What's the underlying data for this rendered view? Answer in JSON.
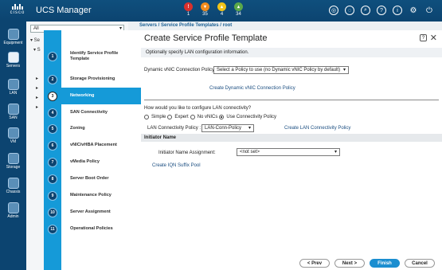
{
  "app": {
    "logo": "cisco",
    "title": "UCS Manager"
  },
  "faults": [
    {
      "label": "1",
      "color": "#d9302c",
      "icon": "critical-icon"
    },
    {
      "label": "35",
      "color": "#f08b1c",
      "icon": "major-icon"
    },
    {
      "label": "4",
      "color": "#f0c419",
      "icon": "minor-icon"
    },
    {
      "label": "34",
      "color": "#5aa84a",
      "icon": "warning-icon"
    }
  ],
  "rail": [
    {
      "label": "Equipment"
    },
    {
      "label": "Servers"
    },
    {
      "label": "LAN"
    },
    {
      "label": "SAN"
    },
    {
      "label": "VM"
    },
    {
      "label": "Storage"
    },
    {
      "label": "Chassis"
    },
    {
      "label": "Admin"
    }
  ],
  "tree": {
    "filter_value": "All",
    "rows": [
      "▾ Se",
      "▾ S",
      "▸",
      "▸",
      "▸",
      "▸"
    ]
  },
  "breadcrumb": "Servers / Service Profile Templates / root",
  "wizard": {
    "title": "Create Service Profile Template",
    "help_label": "?",
    "close_label": "✕",
    "subtitle": "Optionally specify LAN configuration information.",
    "steps": [
      {
        "num": "1",
        "label": "Identify Service Profile Template"
      },
      {
        "num": "2",
        "label": "Storage Provisioning"
      },
      {
        "num": "3",
        "label": "Networking"
      },
      {
        "num": "4",
        "label": "SAN Connectivity"
      },
      {
        "num": "5",
        "label": "Zoning"
      },
      {
        "num": "6",
        "label": "vNIC/vHBA Placement"
      },
      {
        "num": "7",
        "label": "vMedia Policy"
      },
      {
        "num": "8",
        "label": "Server Boot Order"
      },
      {
        "num": "9",
        "label": "Maintenance Policy"
      },
      {
        "num": "10",
        "label": "Server Assignment"
      },
      {
        "num": "11",
        "label": "Operational Policies"
      }
    ],
    "active_step": "3",
    "dynamic_vnic_label": "Dynamic vNIC Connection Policy:",
    "dynamic_vnic_value": "Select a Policy to use (no Dynamic vNIC Policy by default)",
    "create_dynamic_link": "Create Dynamic vNIC Connection Policy",
    "lan_question": "How would you like to configure LAN connectivity?",
    "radio_options": [
      "Simple",
      "Expert",
      "No vNICs",
      "Use Connectivity Policy"
    ],
    "radio_selected": "Use Connectivity Policy",
    "lan_policy_label": "LAN Connectivity Policy :",
    "lan_policy_value": "LAN-Conn-Policy",
    "create_lan_link": "Create LAN Connectivity Policy",
    "initiator_header": "Initiator Name",
    "initiator_label": "Initiator Name Assignment:",
    "initiator_value": "<not set>",
    "create_iqn_link": "Create IQN Suffix Pool",
    "buttons": {
      "prev": "< Prev",
      "next": "Next >",
      "finish": "Finish",
      "cancel": "Cancel"
    }
  }
}
